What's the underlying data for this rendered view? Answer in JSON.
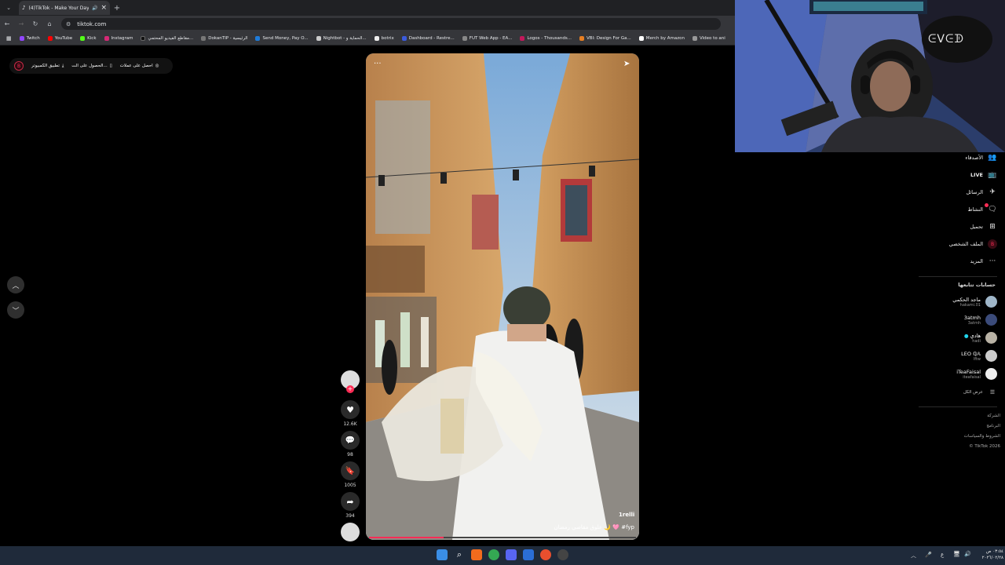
{
  "browser": {
    "tab_title": "(4)TikTok - Make Your Day",
    "tab_close": "×",
    "tab_add": "+",
    "url": "tiktok.com",
    "bookmarks": [
      "Twitch",
      "YouTube",
      "Kick",
      "Instagram",
      "مقاطع الفيديو المحتمي...",
      "DokanTIP - الرئيسية",
      "Send Money, Pay O...",
      "Nightbot - الحماية و...",
      "botrix",
      "Dashboard - Restre...",
      "FUT Web App - EA...",
      "Logos - Thousands...",
      "VBI: Design For Ga...",
      "Merch by Amazon",
      "Video to ani"
    ]
  },
  "topbar": {
    "item1": "احصل على عملات",
    "item2": "الحصول على الت...",
    "item3": "تطبيق الكمبيوتر"
  },
  "video": {
    "caption": "علوق مقاصي رمضان 🌙 🩷 #fyp",
    "watermark": "1relli",
    "more_icon": "···",
    "progress": 0.28
  },
  "actions": {
    "likes": "12.6K",
    "comments": "98",
    "saves": "1005",
    "shares": "394"
  },
  "webcam": {
    "overlay_text": "ᕮᐯᕮᗫ"
  },
  "sidebar": {
    "items": [
      {
        "label": "الأصدقاء",
        "icon": "friends-icon"
      },
      {
        "label": "LIVE",
        "icon": "live-icon"
      },
      {
        "label": "الرسائل",
        "icon": "messages-icon"
      },
      {
        "label": "النشاط",
        "icon": "activity-icon"
      },
      {
        "label": "تحميل",
        "icon": "upload-icon"
      },
      {
        "label": "الملف الشخصي",
        "icon": "profile-icon"
      },
      {
        "label": "المزيد",
        "icon": "more-icon"
      }
    ],
    "following_title": "حسابات تتابعها",
    "accounts": [
      {
        "name": "ماجد الحكمي",
        "handle": "hakami.01"
      },
      {
        "name": "3atmh",
        "handle": "3atmh"
      },
      {
        "name": "هادي",
        "handle": "hadi"
      },
      {
        "name": "LEO ℚ𝔸",
        "handle": "lftw"
      },
      {
        "name": "iTeaFaisal",
        "handle": "iteafaisal"
      }
    ],
    "see_all": "عرض الكل",
    "footer": [
      "الشركة",
      "البرنامج",
      "الشروط والسياسات",
      "© TikTok 2026"
    ]
  },
  "taskbar": {
    "lang": "ع",
    "clock_time": "٠٣:٥٤ ص",
    "clock_date": "٢٠٢٦/٠٢/٢٨"
  }
}
